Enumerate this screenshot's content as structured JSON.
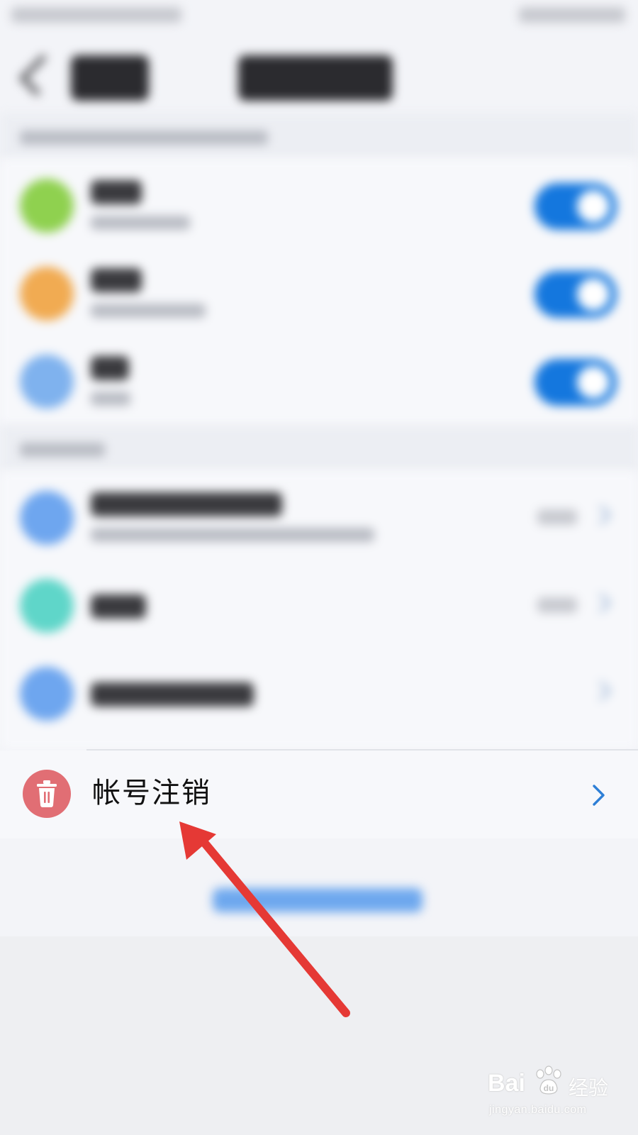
{
  "account_cancel": {
    "label": "帐号注销",
    "icon": "trash-icon",
    "icon_color": "#e16e74"
  },
  "toggle_color": "#1477de",
  "link_color": "#6ea8ee",
  "annotation_arrow_color": "#e53935",
  "watermark": {
    "brand": "Bai",
    "brand_suffix": "经验",
    "url": "jingyan.baidu.com"
  }
}
